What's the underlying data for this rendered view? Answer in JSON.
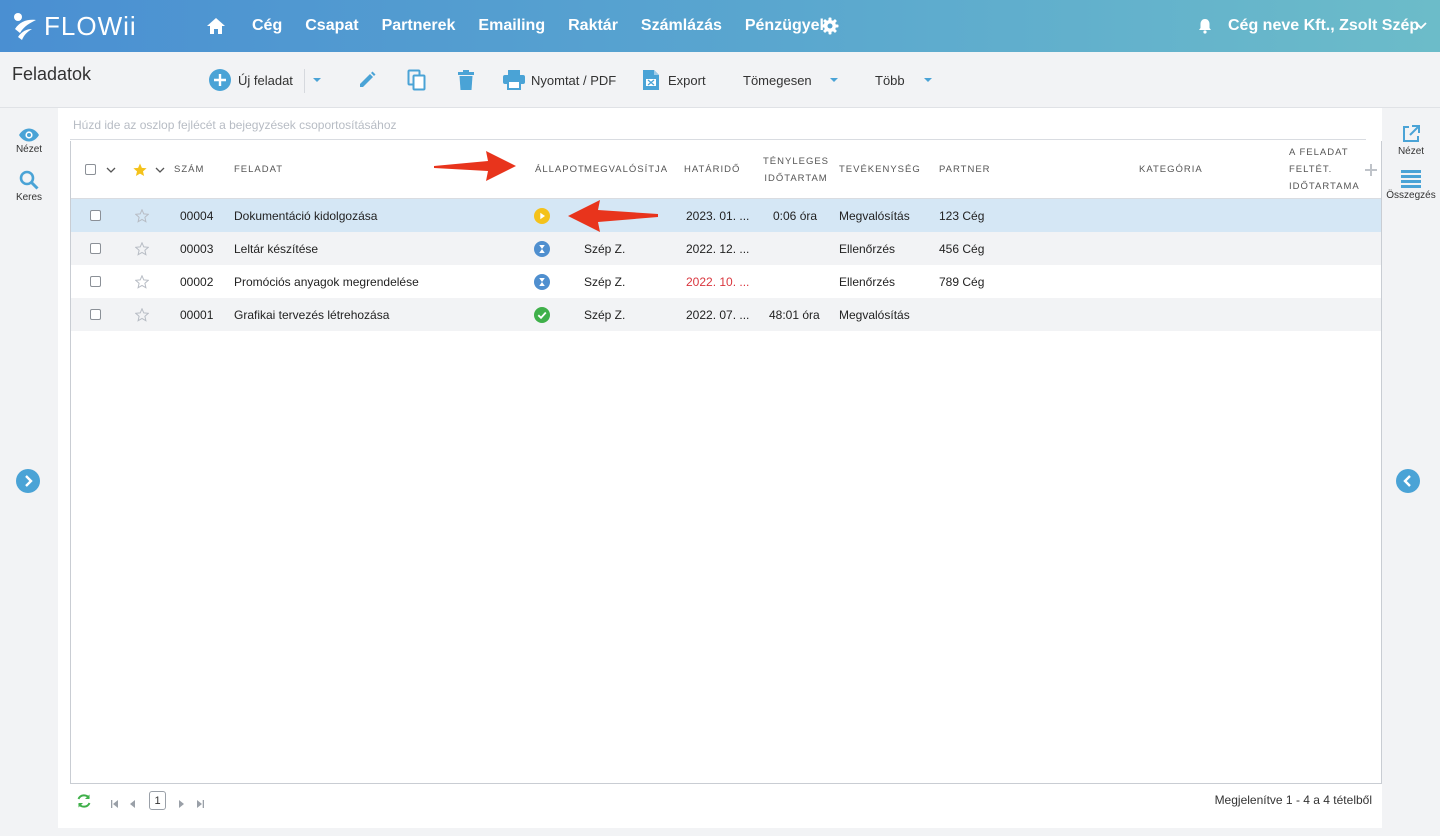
{
  "brand": {
    "name": "FLOWii"
  },
  "nav": {
    "items": [
      {
        "name": "nav-ceg",
        "label": "Cég"
      },
      {
        "name": "nav-csapat",
        "label": "Csapat"
      },
      {
        "name": "nav-partnerek",
        "label": "Partnerek"
      },
      {
        "name": "nav-emailing",
        "label": "Emailing"
      },
      {
        "name": "nav-raktar",
        "label": "Raktár"
      },
      {
        "name": "nav-szamlazas",
        "label": "Számlázás"
      },
      {
        "name": "nav-penzugyek",
        "label": "Pénzügyek"
      }
    ],
    "user": "Cég neve Kft., Zsolt Szép"
  },
  "toolbar": {
    "title": "Feladatok",
    "new_task": "Új feladat",
    "print": "Nyomtat / PDF",
    "export": "Export",
    "bulk": "Tömegesen",
    "more": "Több"
  },
  "left_rail": {
    "view": "Nézet",
    "search": "Keres"
  },
  "right_rail": {
    "view": "Nézet",
    "summary": "Összegzés"
  },
  "grid": {
    "group_hint": "Húzd ide az oszlop fejlécét a bejegyzések csoportosításához",
    "headers": {
      "number": "Szám",
      "task": "Feladat",
      "status": "Állapot",
      "assignee": "Megvalósítja",
      "deadline": "Határidő",
      "actual_1": "Tényleges",
      "actual_2": "időtartam",
      "activity": "Tevékenység",
      "partner": "Partner",
      "category": "Kategória",
      "cond_1": "A feladat",
      "cond_2": "feltét.",
      "cond_3": "időtartama"
    },
    "rows": [
      {
        "number": "00004",
        "task": "Dokumentáció kidolgozása",
        "status": "in-progress",
        "assignee": "",
        "deadline": "2023. 01. ...",
        "duration": "0:06 óra",
        "activity": "Megvalósítás",
        "partner": "123 Cég",
        "selected": true,
        "overdue": false
      },
      {
        "number": "00003",
        "task": "Leltár készítése",
        "status": "waiting",
        "assignee": "Szép Z.",
        "deadline": "2022. 12. ...",
        "duration": "",
        "activity": "Ellenőrzés",
        "partner": "456 Cég",
        "selected": false,
        "overdue": false
      },
      {
        "number": "00002",
        "task": "Promóciós anyagok megrendelése",
        "status": "waiting",
        "assignee": "Szép Z.",
        "deadline": "2022. 10. ...",
        "duration": "",
        "activity": "Ellenőrzés",
        "partner": "789 Cég",
        "selected": false,
        "overdue": true
      },
      {
        "number": "00001",
        "task": "Grafikai tervezés létrehozása",
        "status": "done",
        "assignee": "Szép Z.",
        "deadline": "2022. 07. ...",
        "duration": "48:01 óra",
        "activity": "Megvalósítás",
        "partner": "",
        "selected": false,
        "overdue": false
      }
    ]
  },
  "footer": {
    "page": "1",
    "summary": "Megjelenítve 1 - 4 a 4 tételből"
  },
  "colors": {
    "accent": "#4aa3d6",
    "status_in_progress": "#f4c21b",
    "status_waiting": "#4f8fcf",
    "status_done": "#3fb04a",
    "overdue": "#d9363e",
    "annotation": "#e8341c"
  }
}
